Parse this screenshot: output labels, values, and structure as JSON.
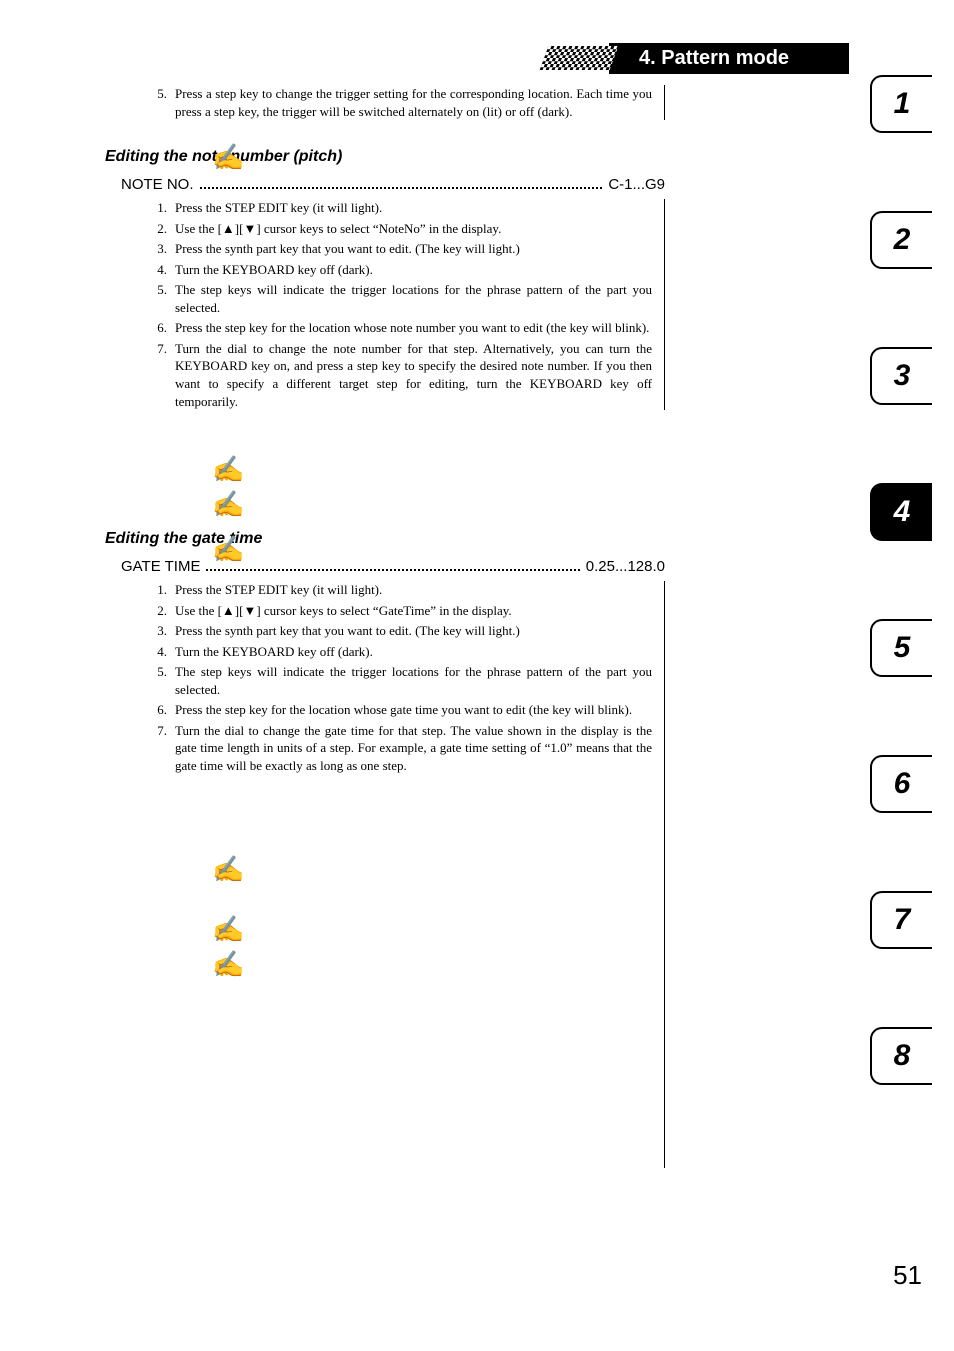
{
  "chapter": {
    "title": "4. Pattern mode"
  },
  "intro_steps": [
    {
      "n": "5.",
      "t": "Press a step key to change the trigger setting for the corresponding location. Each time you press a step key, the trigger will be switched alternately on (lit) or off (dark)."
    }
  ],
  "section_note": {
    "heading": "Editing the note number (pitch)",
    "param_label": "NOTE NO.",
    "param_value": "C-1...G9",
    "steps": [
      {
        "n": "1.",
        "t": "Press the STEP EDIT key (it will light)."
      },
      {
        "n": "2.",
        "t": "Use the [▲][▼] cursor keys to select “NoteNo” in the display."
      },
      {
        "n": "3.",
        "t": "Press the synth part key that you want to edit. (The key will light.)"
      },
      {
        "n": "4.",
        "t": "Turn the KEYBOARD key off (dark)."
      },
      {
        "n": "5.",
        "t": "The step keys will indicate the trigger locations for the phrase pattern of the part you selected."
      },
      {
        "n": "6.",
        "t": "Press the step key for the location whose note number you want to edit (the key will blink)."
      },
      {
        "n": "7.",
        "t": "Turn the dial to change the note number for that step. Alternatively, you can turn the KEYBOARD key on, and press a step key to specify the desired note number. If you then want to specify a different target step for editing, turn the KEYBOARD key off temporarily."
      }
    ]
  },
  "section_gate": {
    "heading": "Editing the gate time",
    "param_label": "GATE TIME",
    "param_value": "0.25...128.0",
    "steps": [
      {
        "n": "1.",
        "t": "Press the STEP EDIT key (it will light)."
      },
      {
        "n": "2.",
        "t": "Use the [▲][▼] cursor keys to select “GateTime” in the display."
      },
      {
        "n": "3.",
        "t": "Press the synth part key that you want to edit. (The key will light.)"
      },
      {
        "n": "4.",
        "t": "Turn the KEYBOARD key off (dark)."
      },
      {
        "n": "5.",
        "t": "The step keys will indicate the trigger locations for the phrase pattern of the part you selected."
      },
      {
        "n": "6.",
        "t": "Press the step key for the location whose gate time you want to edit (the key will blink)."
      },
      {
        "n": "7.",
        "t": "Turn the dial to change the gate time for that step. The value shown in the display is the gate time length in units of a step. For example, a gate time setting of “1.0” means that the gate time will be exactly as long as one step."
      }
    ]
  },
  "tabs": [
    "1",
    "2",
    "3",
    "4",
    "5",
    "6",
    "7",
    "8"
  ],
  "active_tab_index": 3,
  "page_number": "51"
}
